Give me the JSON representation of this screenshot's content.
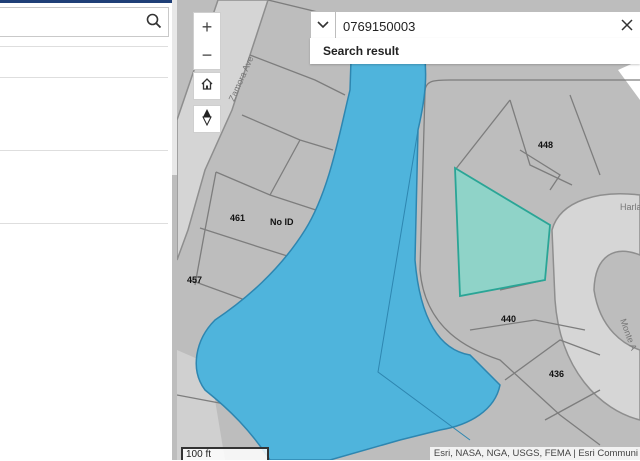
{
  "sidebar": {
    "search": {
      "value": "",
      "placeholder": ""
    }
  },
  "map": {
    "street_labels": [
      "Zamora Ave",
      "Harla",
      "Monte A"
    ],
    "parcel_labels": [
      "448",
      "461",
      "No ID",
      "457",
      "440",
      "436"
    ],
    "scale_label": "100 ft",
    "attribution": "Esri, NASA, NGA, USGS, FEMA | Esri Communi"
  },
  "map_search": {
    "value": "0769150003",
    "results_label": "Search result"
  },
  "controls": {
    "zoom_in": "+",
    "zoom_out": "−"
  },
  "colors": {
    "water": "#4fb4dc",
    "selected_parcel": "#8fd3c8",
    "parcel": "#bdbdbd",
    "road": "#d6d6d6"
  }
}
